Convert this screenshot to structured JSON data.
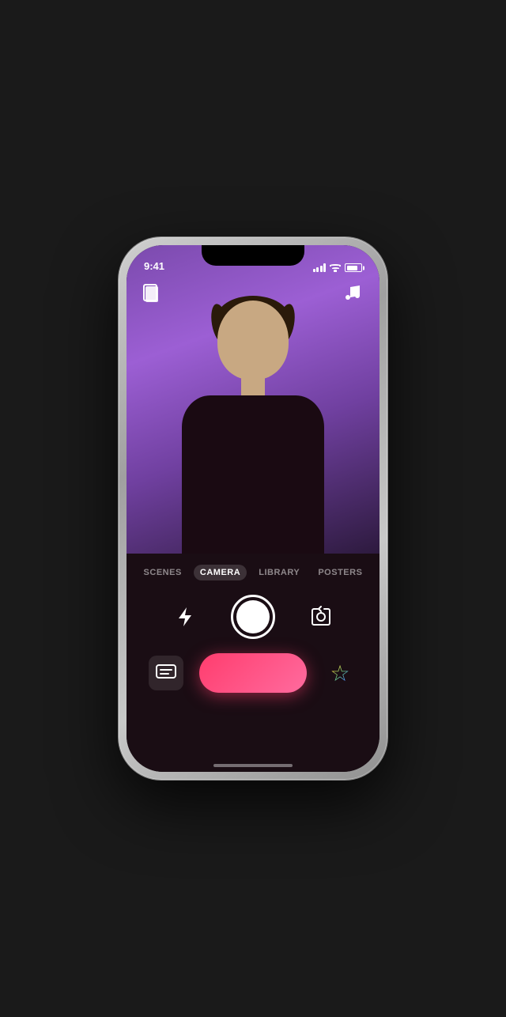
{
  "status_bar": {
    "time": "9:41"
  },
  "toolbar": {
    "sticker_label": "sticker",
    "music_label": "music"
  },
  "tabs": [
    {
      "id": "scenes",
      "label": "SCENES",
      "active": false
    },
    {
      "id": "camera",
      "label": "CAMERA",
      "active": true
    },
    {
      "id": "library",
      "label": "LIBRARY",
      "active": false
    },
    {
      "id": "posters",
      "label": "POSTERS",
      "active": false
    }
  ],
  "camera_controls": {
    "flash_label": "flash",
    "capture_label": "capture",
    "flip_label": "flip camera"
  },
  "action_bar": {
    "message_label": "message",
    "record_label": "record",
    "favorites_label": "favorites"
  },
  "home_indicator": "home"
}
